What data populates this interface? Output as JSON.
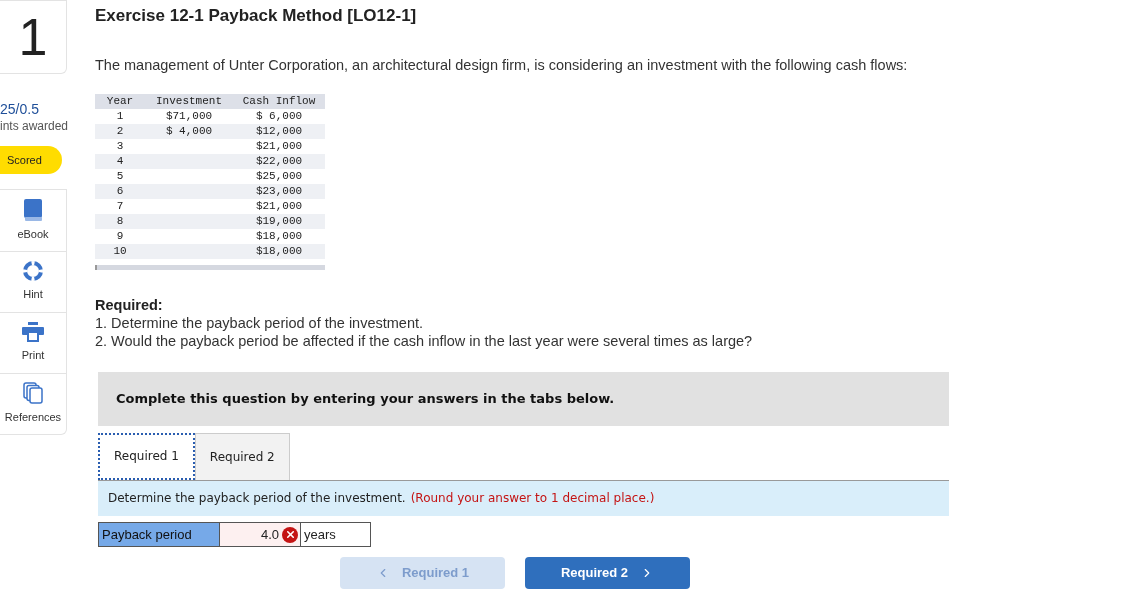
{
  "question_number": "1",
  "score": {
    "points": "25/0.5",
    "caption": "ints awarded",
    "badge": "Scored"
  },
  "tools": [
    {
      "kind": "ebook",
      "label": "eBook"
    },
    {
      "kind": "hint",
      "label": "Hint"
    },
    {
      "kind": "print",
      "label": "Print"
    },
    {
      "kind": "references",
      "label": "References"
    }
  ],
  "title": "Exercise 12-1 Payback Method [LO12-1]",
  "intro": "The management of Unter Corporation, an architectural design firm, is considering an investment with the following cash flows:",
  "table": {
    "columns": [
      "Year",
      "Investment",
      "Cash Inflow"
    ],
    "rows": [
      [
        "1",
        "$71,000",
        "$ 6,000"
      ],
      [
        "2",
        "$ 4,000",
        "$12,000"
      ],
      [
        "3",
        "",
        "$21,000"
      ],
      [
        "4",
        "",
        "$22,000"
      ],
      [
        "5",
        "",
        "$25,000"
      ],
      [
        "6",
        "",
        "$23,000"
      ],
      [
        "7",
        "",
        "$21,000"
      ],
      [
        "8",
        "",
        "$19,000"
      ],
      [
        "9",
        "",
        "$18,000"
      ],
      [
        "10",
        "",
        "$18,000"
      ]
    ]
  },
  "required": {
    "heading": "Required:",
    "items": [
      "1. Determine the payback period of the investment.",
      "2. Would the payback period be affected if the cash inflow in the last year were several times as large?"
    ]
  },
  "banner": "Complete this question by entering your answers in the tabs below.",
  "tabs": [
    {
      "label": "Required 1",
      "selected": true
    },
    {
      "label": "Required 2",
      "selected": false
    }
  ],
  "instruction": {
    "text": "Determine the payback period of the investment.",
    "note": "(Round your answer to 1 decimal place.)"
  },
  "answer": {
    "label": "Payback period",
    "value": "4.0",
    "incorrect": true,
    "unit": "years"
  },
  "nav": [
    {
      "label": "Required 1",
      "kind": "prev",
      "disabled": true
    },
    {
      "label": "Required 2",
      "kind": "next",
      "disabled": false
    }
  ]
}
